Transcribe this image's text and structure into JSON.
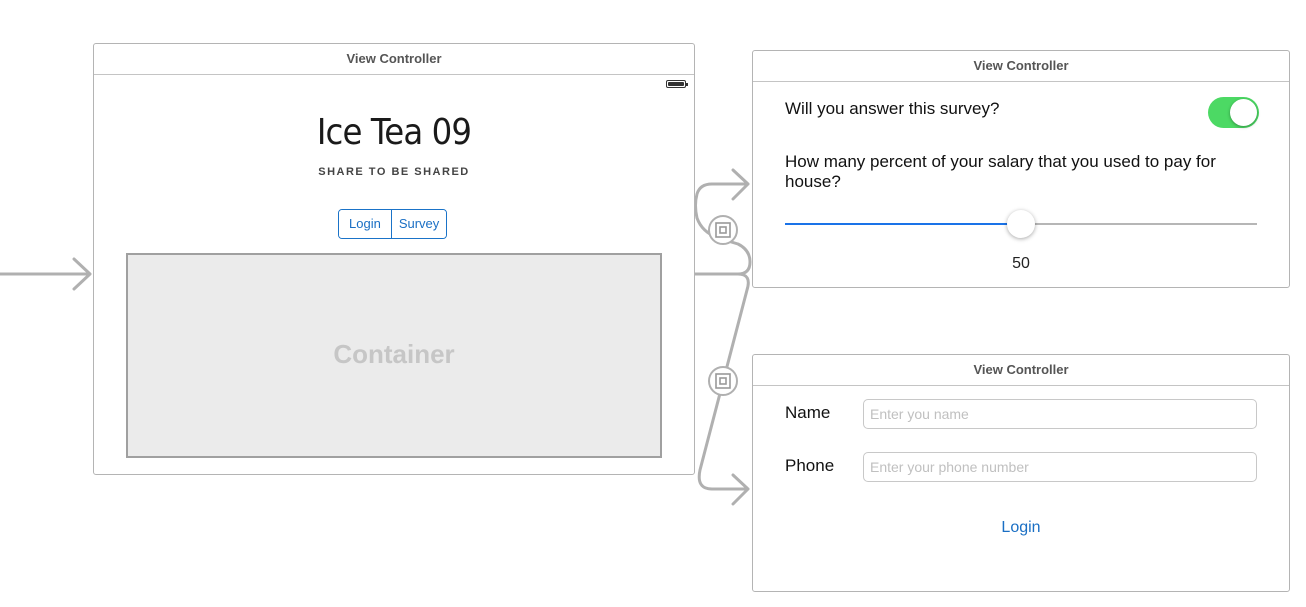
{
  "scene_main": {
    "title": "View Controller",
    "app_title": "Ice Tea 09",
    "subtitle": "SHARE TO BE SHARED",
    "segments": [
      "Login",
      "Survey"
    ],
    "container_label": "Container"
  },
  "scene_survey": {
    "title": "View Controller",
    "question1": "Will you answer this survey?",
    "switch_on": true,
    "question2": "How many percent of your salary that you used to pay for house?",
    "slider_min": 0,
    "slider_max": 100,
    "slider_value": 50,
    "slider_value_text": "50"
  },
  "scene_login": {
    "title": "View Controller",
    "name_label": "Name",
    "name_placeholder": "Enter you name",
    "phone_label": "Phone",
    "phone_placeholder": "Enter your phone number",
    "login_label": "Login"
  },
  "colors": {
    "accent": "#1a6fc4",
    "switch_on": "#4cd964",
    "segue_line": "#b0b0b0",
    "container_fill": "#ebebeb"
  },
  "icons": {
    "segue": "embed-segue-icon",
    "entry": "entry-point-arrow-icon"
  }
}
